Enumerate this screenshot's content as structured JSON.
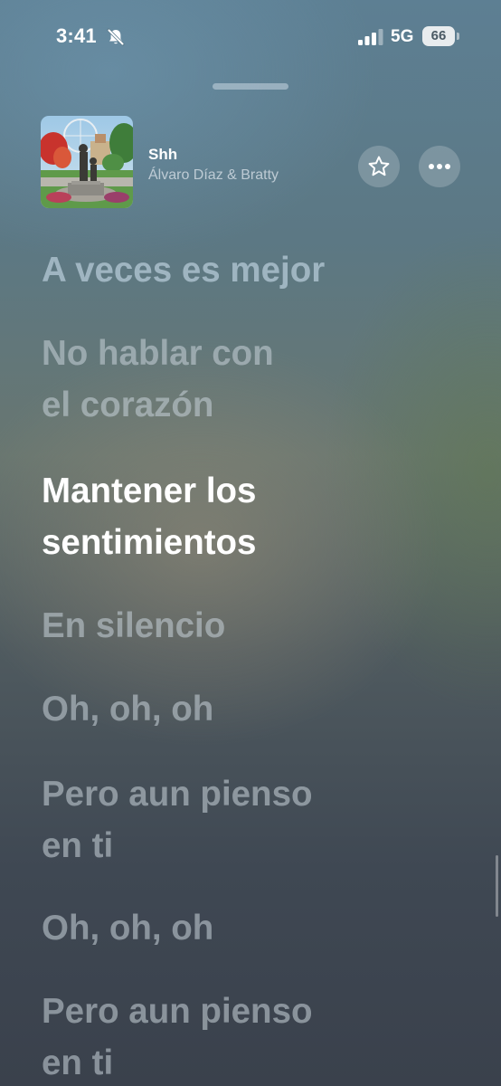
{
  "status_bar": {
    "time": "3:41",
    "network": "5G",
    "battery": "66",
    "icons": [
      "bell-slash-icon",
      "cellular-signal-icon",
      "battery-icon"
    ]
  },
  "now_playing": {
    "title": "Shh",
    "artist": "Álvaro Díaz & Bratty",
    "favorite_icon": "star-icon",
    "more_icon": "ellipsis-icon"
  },
  "lyrics": [
    {
      "text": "A veces es mejor",
      "active": false
    },
    {
      "text": "No hablar con\nel corazón",
      "active": false
    },
    {
      "text": "Mantener los\nsentimientos",
      "active": true
    },
    {
      "text": "En silencio",
      "active": false
    },
    {
      "text": "Oh, oh, oh",
      "active": false
    },
    {
      "text": "Pero aun pienso\nen ti",
      "active": false
    },
    {
      "text": "Oh, oh, oh",
      "active": false
    },
    {
      "text": "Pero aun pienso\nen ti",
      "active": false
    }
  ],
  "colors": {
    "active_lyric": "#ffffff",
    "inactive_lyric": "#c3cdd4",
    "accent_ui": "#ffffff"
  }
}
